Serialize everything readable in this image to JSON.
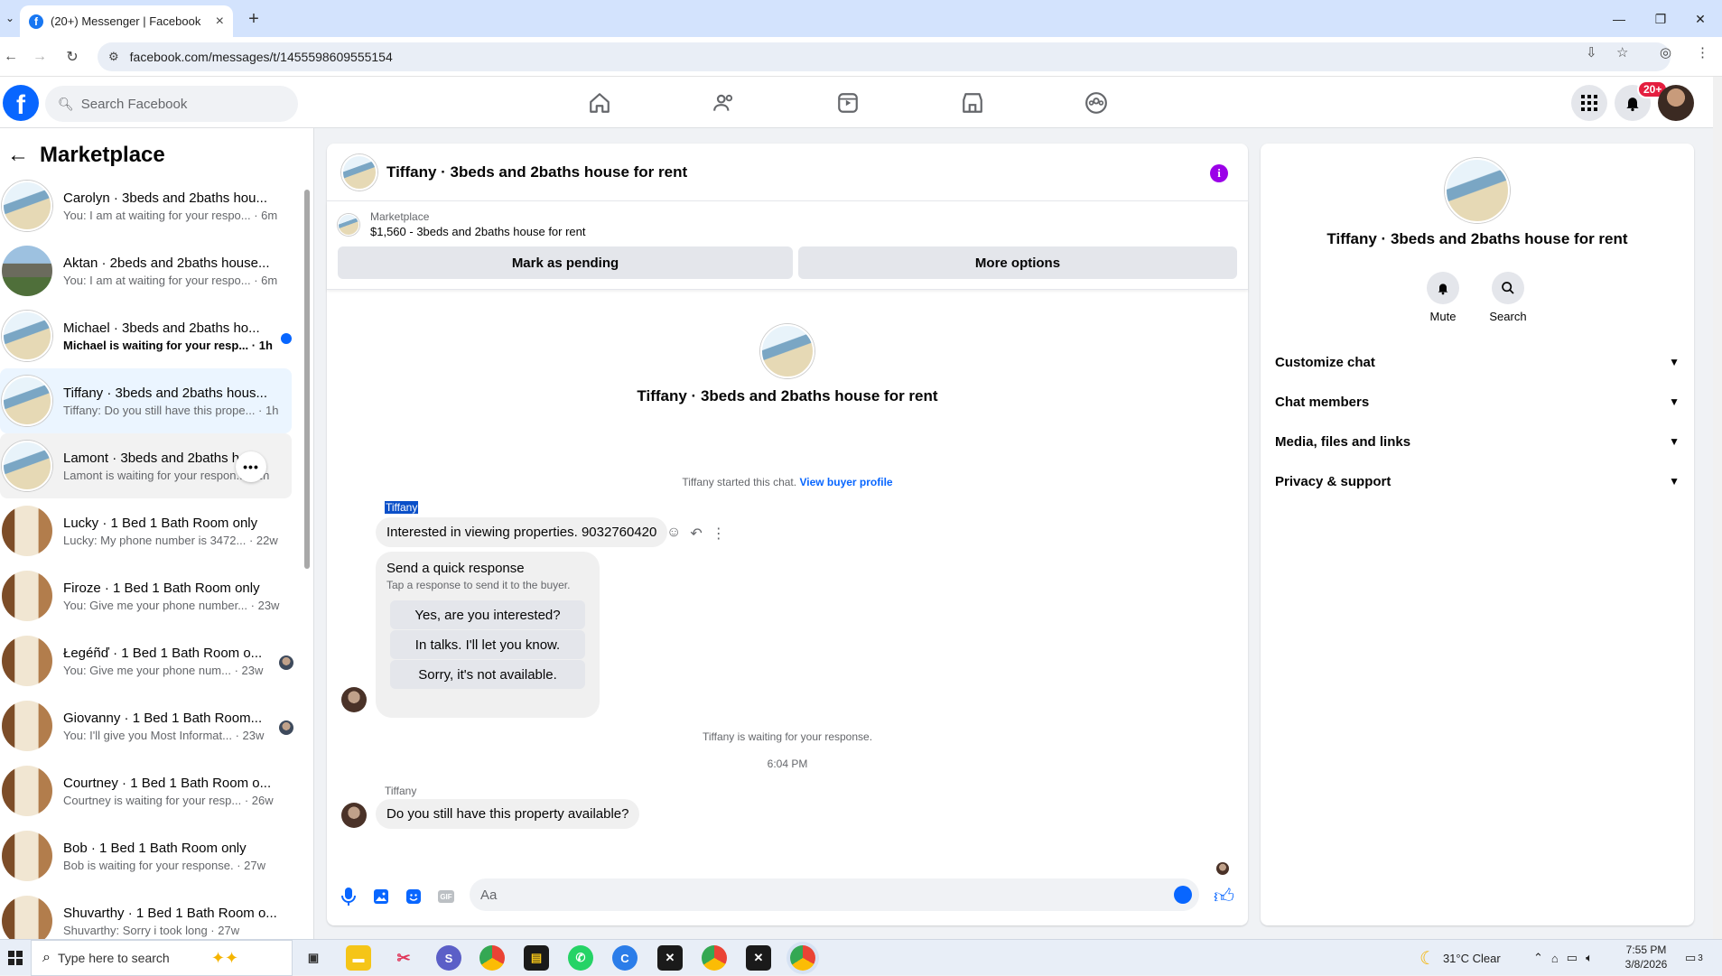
{
  "browser": {
    "tab_title": "(20+) Messenger | Facebook",
    "url": "facebook.com/messages/t/1455598609555154"
  },
  "fbnav": {
    "search_placeholder": "Search Facebook",
    "notification_badge": "20+"
  },
  "left": {
    "heading": "Marketplace",
    "conversations": [
      {
        "name": "Carolyn · 3beds and 2baths hou...",
        "preview": "You: I am at waiting for your respo... · 6m",
        "avatar": "house",
        "state": "normal"
      },
      {
        "name": "Aktan · 2beds and 2baths house...",
        "preview": "You: I am at waiting for your respo... · 6m",
        "avatar": "exterior",
        "state": "normal"
      },
      {
        "name": "Michael · 3beds and 2baths ho...",
        "preview": "Michael is waiting for your resp... · 1h",
        "avatar": "house",
        "state": "unread"
      },
      {
        "name": "Tiffany · 3beds and 2baths hous...",
        "preview": "Tiffany: Do you still have this prope... · 1h",
        "avatar": "house",
        "state": "active"
      },
      {
        "name": "Lamont · 3beds and 2baths h...",
        "preview": "Lamont is waiting for your respon... · 1h",
        "avatar": "house",
        "state": "hover"
      },
      {
        "name": "Lucky · 1 Bed 1 Bath Room only",
        "preview": "Lucky: My phone number is 3472... · 22w",
        "avatar": "room",
        "state": "normal"
      },
      {
        "name": "Firoze · 1 Bed 1 Bath Room only",
        "preview": "You: Give me your phone number... · 23w",
        "avatar": "room",
        "state": "normal"
      },
      {
        "name": "Łegéñď · 1 Bed 1 Bath Room o...",
        "preview": "You: Give me your phone num... · 23w",
        "avatar": "room",
        "state": "seen"
      },
      {
        "name": "Giovanny · 1 Bed 1 Bath Room...",
        "preview": "You: I'll give you Most Informat... · 23w",
        "avatar": "room",
        "state": "seen"
      },
      {
        "name": "Courtney · 1 Bed 1 Bath Room o...",
        "preview": "Courtney is waiting for your resp... · 26w",
        "avatar": "room",
        "state": "normal"
      },
      {
        "name": "Bob · 1 Bed 1 Bath Room only",
        "preview": "Bob is waiting for your response. · 27w",
        "avatar": "room",
        "state": "normal"
      },
      {
        "name": "Shuvarthy · 1 Bed 1 Bath Room o...",
        "preview": "Shuvarthy: Sorry i took long · 27w",
        "avatar": "room",
        "state": "normal"
      }
    ]
  },
  "chat": {
    "title": "Tiffany · 3beds and 2baths house for rent",
    "marketplace_label": "Marketplace",
    "listing": "$1,560 - 3beds and 2baths house for rent",
    "mark_pending": "Mark as pending",
    "more_options": "More options",
    "center_name": "Tiffany · 3beds and 2baths house for rent",
    "started_text": "Tiffany started this chat.",
    "view_profile": "View buyer profile",
    "sender1": "Tiffany",
    "message1": "Interested in viewing properties. 9032760420",
    "quick_heading": "Send a quick response",
    "quick_sub": "Tap a response to send it to the buyer.",
    "quick_1": "Yes, are you interested?",
    "quick_2": "In talks. I'll let you know.",
    "quick_3": "Sorry, it's not available.",
    "waiting": "Tiffany is waiting for your response.",
    "time": "6:04 PM",
    "sender2": "Tiffany",
    "message2": "Do you still have this property available?",
    "composer_placeholder": "Aa"
  },
  "details": {
    "name": "Tiffany · 3beds and 2baths house for rent",
    "mute": "Mute",
    "search": "Search",
    "rows": [
      "Customize chat",
      "Chat members",
      "Media, files and links",
      "Privacy & support"
    ]
  },
  "taskbar": {
    "search_placeholder": "Type here to search",
    "weather": "31°C  Clear",
    "time": "7:55 PM",
    "date": "3/8/2026",
    "notif_count": "3"
  }
}
